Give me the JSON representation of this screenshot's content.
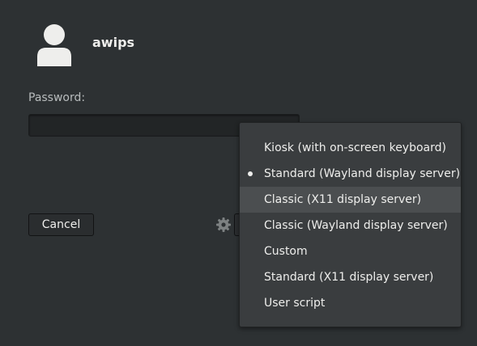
{
  "user": {
    "name": "awips",
    "avatar_icon": "user-avatar-icon"
  },
  "password": {
    "label": "Password:",
    "value": ""
  },
  "buttons": {
    "cancel": "Cancel"
  },
  "session_menu": {
    "gear_icon": "gear-icon",
    "items": [
      {
        "label": "Kiosk (with on-screen keyboard)",
        "selected": false,
        "hovered": false
      },
      {
        "label": "Standard (Wayland display server)",
        "selected": true,
        "hovered": false
      },
      {
        "label": "Classic (X11 display server)",
        "selected": false,
        "hovered": true
      },
      {
        "label": "Classic (Wayland display server)",
        "selected": false,
        "hovered": false
      },
      {
        "label": "Custom",
        "selected": false,
        "hovered": false
      },
      {
        "label": "Standard (X11 display server)",
        "selected": false,
        "hovered": false
      },
      {
        "label": "User script",
        "selected": false,
        "hovered": false
      }
    ]
  },
  "colors": {
    "background": "#2d3133",
    "menu_background": "#3a3d3f",
    "menu_hover": "#4b4e50",
    "text": "#eeeeec"
  }
}
